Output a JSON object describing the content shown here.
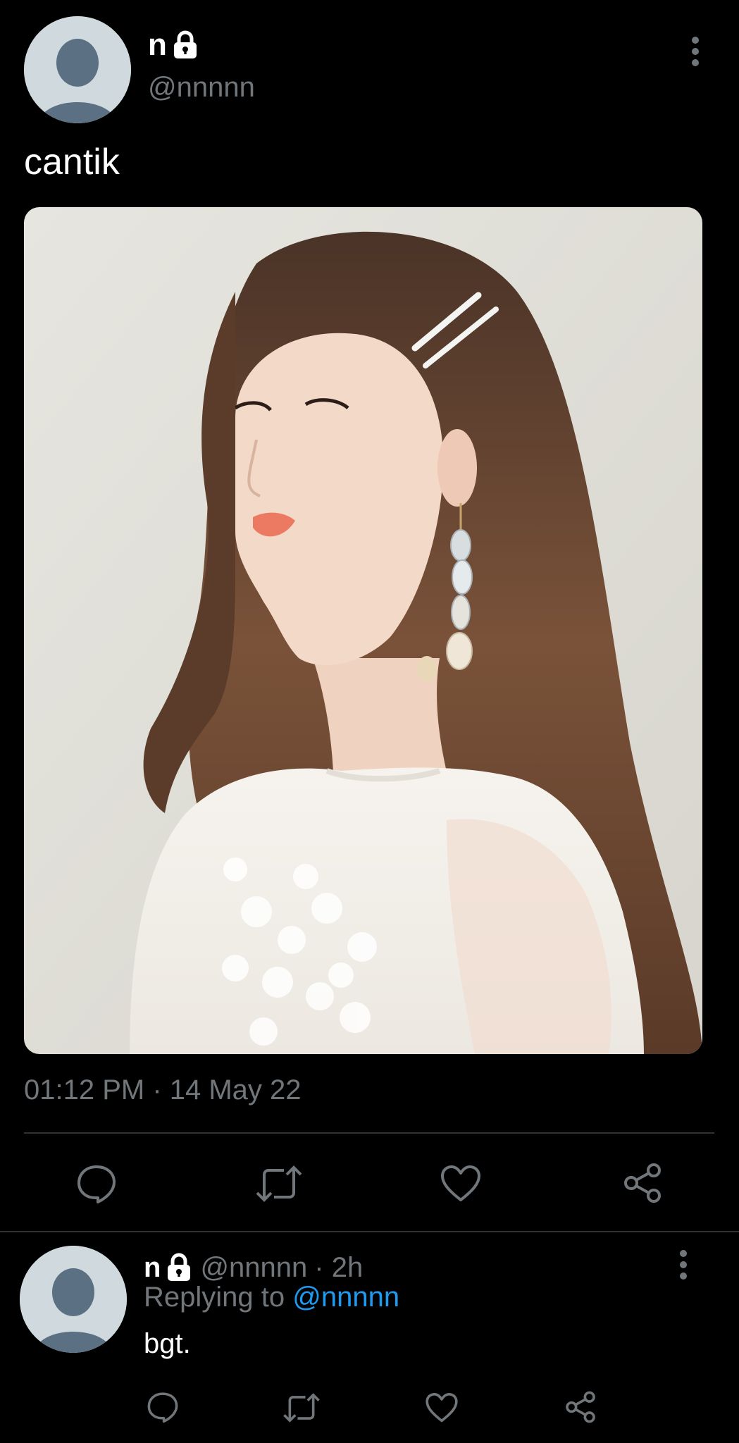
{
  "tweet": {
    "display_name": "n",
    "handle": "@nnnnn",
    "text": "cantik",
    "timestamp": "01:12 PM · 14 May 22",
    "icons": {
      "lock": "lock-icon",
      "more": "more-vertical-icon",
      "reply": "reply-icon",
      "retweet": "retweet-icon",
      "like": "heart-icon",
      "share": "share-icon"
    }
  },
  "reply": {
    "display_name": "n",
    "handle": "@nnnnn",
    "time": "· 2h",
    "replying_to_label": "Replying to",
    "replying_to_handle": "@nnnnn",
    "text": "bgt."
  },
  "colors": {
    "background": "#000000",
    "muted": "#71767b",
    "link": "#1d9bf0",
    "divider": "#2f3336"
  }
}
